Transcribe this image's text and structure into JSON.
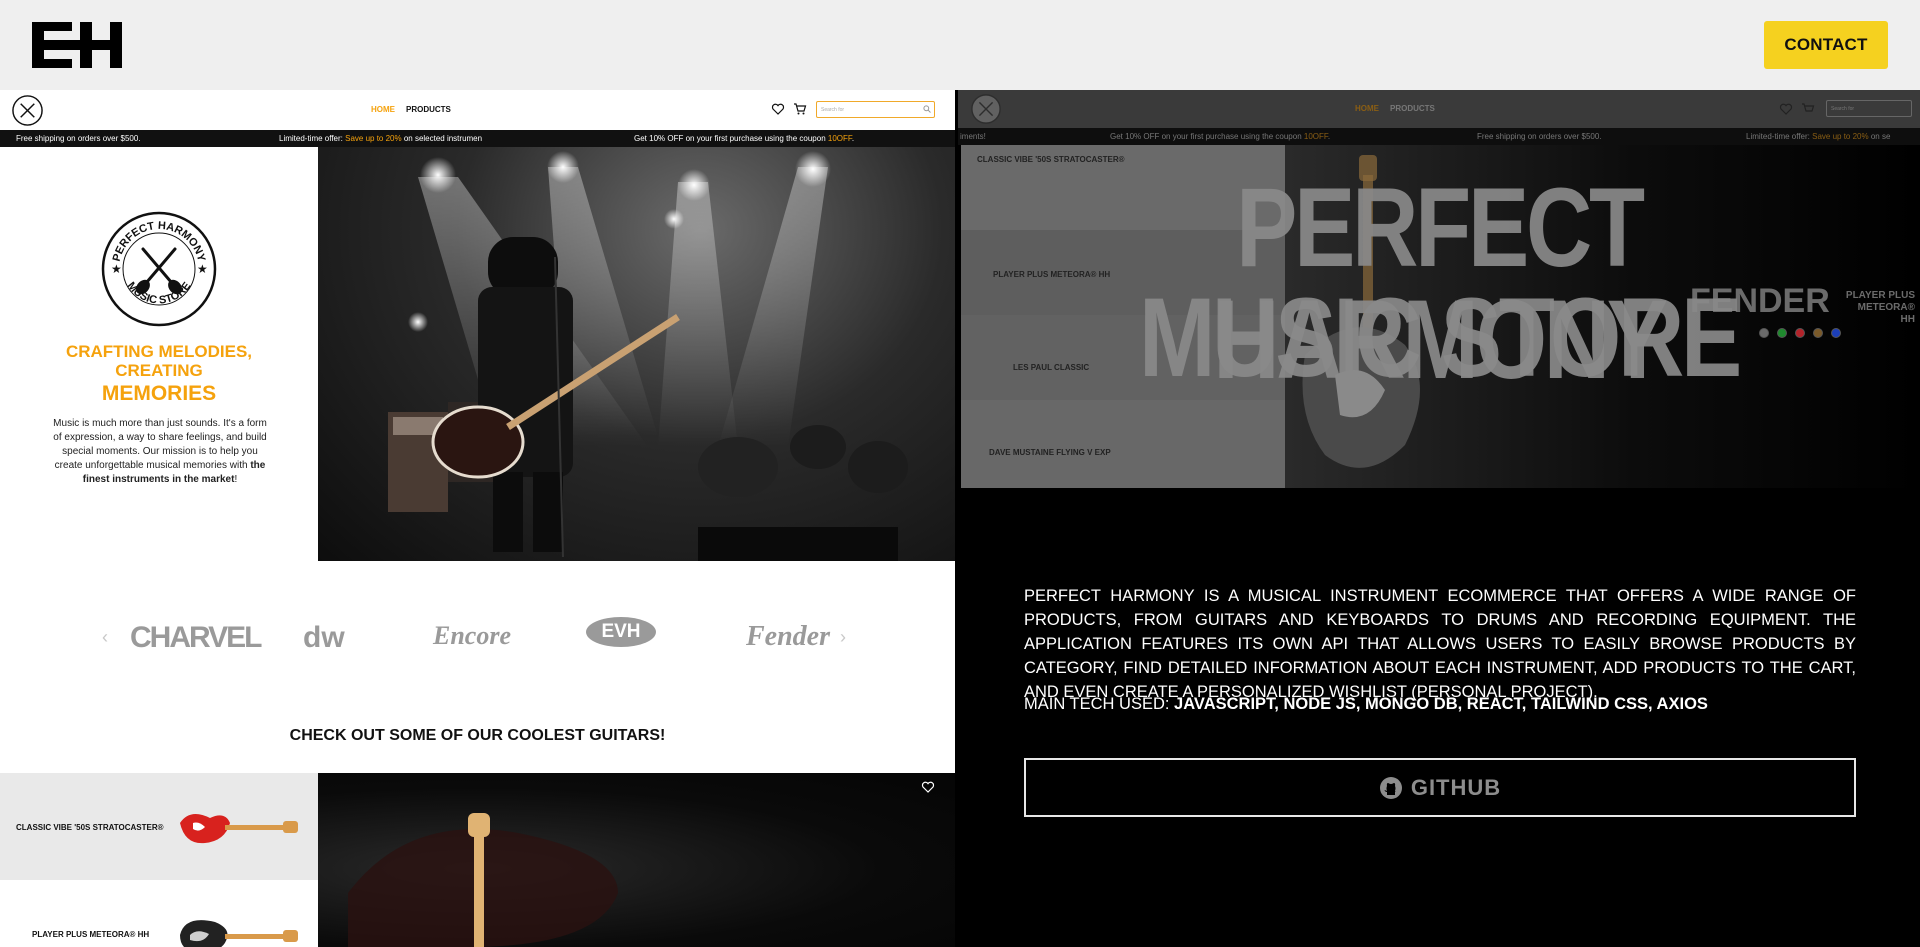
{
  "header": {
    "logo_text": "EH",
    "contact_label": "CONTACT"
  },
  "shop": {
    "nav": {
      "home": "HOME",
      "products": "PRODUCTS",
      "search_placeholder": "Search for"
    },
    "ticker": {
      "t1": "Free shipping on orders over $500.",
      "t2a": "Limited-time offer: ",
      "t2b": "Save up to 20%",
      "t2c": " on selected instrumen",
      "t3a": "Get 10% OFF on your first purchase using the coupon ",
      "t3b": "10OFF",
      "t3c": "."
    },
    "hero": {
      "badge_top": "PERFECT HARMONY",
      "badge_bottom": "MUSIC STORE",
      "tagline_1": "CRAFTING MELODIES,",
      "tagline_2": "CREATING",
      "tagline_3": "MEMORIES",
      "mission": "Music is much more than just sounds. It's a form of expression, a way to share feelings, and build special moments. Our mission is to help you create unforgettable musical memories with ",
      "mission_bold": "the finest instruments in the market",
      "mission_end": "!"
    },
    "brands": [
      "CHARVEL",
      "dw",
      "Encore",
      "EVH",
      "Fender"
    ],
    "section_title": "CHECK OUT SOME OF OUR COOLEST GUITARS!",
    "guitars": [
      {
        "name": "CLASSIC VIBE '50S STRATOCASTER®"
      },
      {
        "name": "PLAYER PLUS METEORA® HH"
      }
    ]
  },
  "project": {
    "nav": {
      "home": "HOME",
      "products": "PRODUCTS",
      "search_placeholder": "Search for"
    },
    "ticker": {
      "t0": "iments!",
      "t1a": "Get 10% OFF on your first purchase using the coupon ",
      "t1b": "10OFF",
      "t1c": ".",
      "t2": "Free shipping on orders over $500.",
      "t3a": "Limited-time offer: ",
      "t3b": "Save up to 20%",
      "t3c": " on se"
    },
    "gallery": [
      "CLASSIC VIBE '50S STRATOCASTER®",
      "PLAYER PLUS METEORA® HH",
      "LES PAUL CLASSIC",
      "DAVE MUSTAINE FLYING V EXP"
    ],
    "feature_brand": "FENDER",
    "feature_model_1": "PLAYER PLUS",
    "feature_model_2": "METEORA® HH",
    "swatch_colors": [
      "#6a6a6a",
      "#1f8a2e",
      "#b3232a",
      "#7a5a2a",
      "#1c3fb8"
    ],
    "title_line_1": "PERFECT HARMONY",
    "title_line_2": "MUSIC STORE",
    "description": "Perfect Harmony is a musical instrument ecommerce that offers a wide range of products, from guitars and keyboards to drums and recording equipment. The application features its own API that allows users to easily browse products by category, find detailed information about each instrument, add products to the cart, and even create a personalized wishlist (personal project).",
    "tech_label": "MAIN TECH USED: ",
    "tech_list": "JAVASCRIPT, NODE JS, MONGO DB, REACT, TAILWIND CSS, AXIOS",
    "github_label": "GITHUB"
  },
  "colors": {
    "accent": "#f5a20d",
    "contact": "#f5d11f"
  }
}
